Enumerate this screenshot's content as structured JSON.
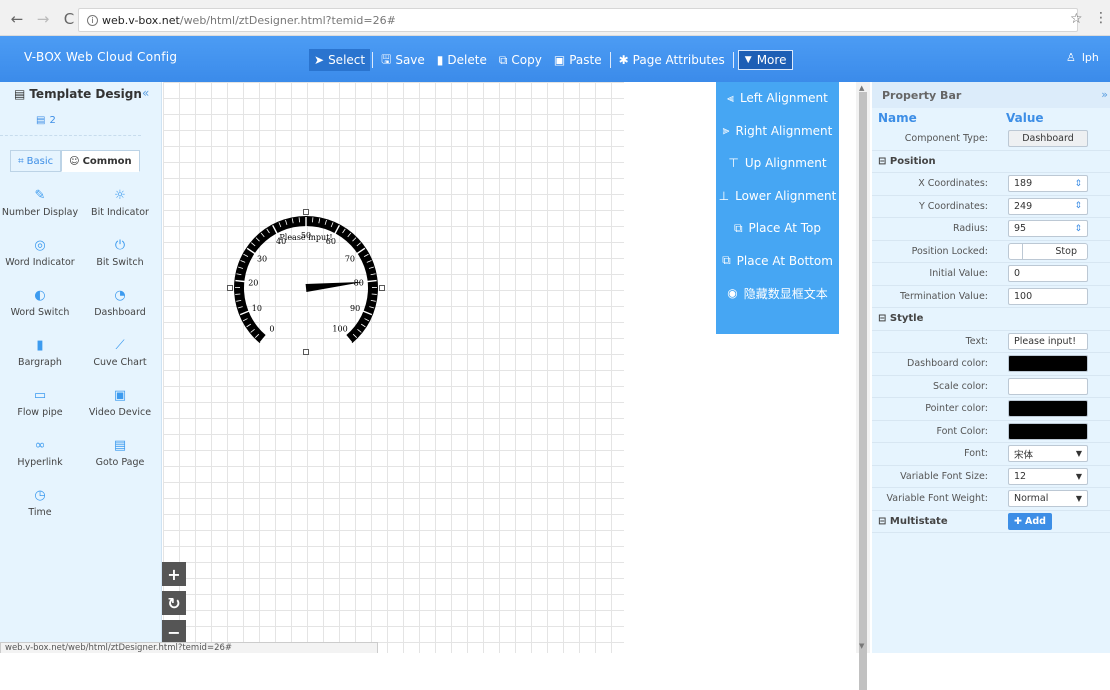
{
  "browser": {
    "url_host": "web.v-box.net",
    "url_path": "/web/html/ztDesigner.html?temid=26#"
  },
  "app": {
    "brand": "V-BOX Web Cloud Config",
    "user": "lph"
  },
  "toolbar": {
    "select": "Select",
    "save": "Save",
    "delete": "Delete",
    "copy": "Copy",
    "paste": "Paste",
    "page_attributes": "Page Attributes",
    "more": "More"
  },
  "left_panel": {
    "title": "Template Design",
    "page": "2",
    "tabs": {
      "basic": "Basic",
      "common": "Common"
    },
    "components": [
      {
        "label": "Number Display",
        "icon": "pencil-square-icon"
      },
      {
        "label": "Bit Indicator",
        "icon": "sun-icon"
      },
      {
        "label": "Word Indicator",
        "icon": "target-icon"
      },
      {
        "label": "Bit Switch",
        "icon": "power-icon"
      },
      {
        "label": "Word Switch",
        "icon": "toggle-icon"
      },
      {
        "label": "Dashboard",
        "icon": "gauge-icon"
      },
      {
        "label": "Bargraph",
        "icon": "bar-icon"
      },
      {
        "label": "Cuve Chart",
        "icon": "chart-icon"
      },
      {
        "label": "Flow pipe",
        "icon": "pipe-icon"
      },
      {
        "label": "Video Device",
        "icon": "video-icon"
      },
      {
        "label": "Hyperlink",
        "icon": "link-icon"
      },
      {
        "label": "Goto Page",
        "icon": "page-icon"
      },
      {
        "label": "Time",
        "icon": "clock-icon"
      }
    ]
  },
  "gauge": {
    "text": "Please input!",
    "ticks": [
      "0",
      "10",
      "20",
      "30",
      "40",
      "50",
      "60",
      "70",
      "80",
      "90",
      "100"
    ],
    "min": 0,
    "max": 100,
    "pointer_value": 80
  },
  "more_menu": {
    "items": [
      "Left Alignment",
      "Right Alignment",
      "Up Alignment",
      "Lower Alignment",
      "Place At Top",
      "Place At Bottom",
      "隐藏数显框文本"
    ]
  },
  "property_bar": {
    "title": "Property Bar",
    "col_name": "Name",
    "col_value": "Value",
    "component_type_label": "Component Type:",
    "component_type": "Dashboard",
    "position_group": "Position",
    "x_label": "X Coordinates:",
    "x": "189",
    "y_label": "Y Coordinates:",
    "y": "249",
    "radius_label": "Radius:",
    "radius": "95",
    "locked_label": "Position Locked:",
    "locked": "Stop",
    "initial_label": "Initial Value:",
    "initial": "0",
    "termination_label": "Termination Value:",
    "termination": "100",
    "style_group": "Stytle",
    "text_label": "Text:",
    "text": "Please input!",
    "dash_color_label": "Dashboard color:",
    "dash_color": "#000000",
    "scale_color_label": "Scale color:",
    "scale_color": "#ffffff",
    "pointer_color_label": "Pointer color:",
    "pointer_color": "#000000",
    "font_color_label": "Font Color:",
    "font_color": "#000000",
    "font_label": "Font:",
    "font": "宋体",
    "font_size_label": "Variable Font Size:",
    "font_size": "12",
    "font_weight_label": "Variable Font Weight:",
    "font_weight": "Normal",
    "multistate_group": "Multistate",
    "add": "Add"
  },
  "status_bar": "web.v-box.net/web/html/ztDesigner.html?temid=26#"
}
